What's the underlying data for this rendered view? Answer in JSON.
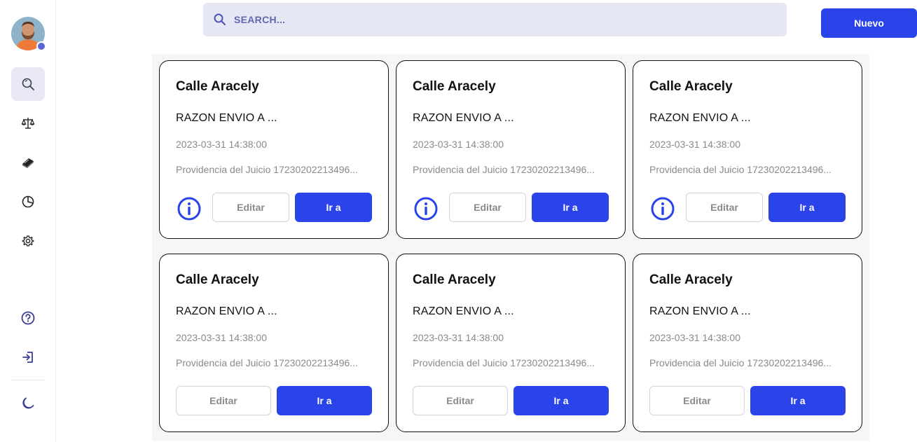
{
  "search": {
    "placeholder": "SEARCH..."
  },
  "header": {
    "new_button": "Nuevo"
  },
  "sidebar": {
    "items": [
      {
        "name": "search",
        "icon": "search-icon",
        "active": true
      },
      {
        "name": "justice",
        "icon": "scale-icon",
        "active": false
      },
      {
        "name": "books",
        "icon": "book-icon",
        "active": false
      },
      {
        "name": "reports",
        "icon": "pie-chart-icon",
        "active": false
      },
      {
        "name": "settings",
        "icon": "gear-icon",
        "active": false
      },
      {
        "name": "help",
        "icon": "help-icon",
        "active": false
      },
      {
        "name": "logout",
        "icon": "logout-icon",
        "active": false
      },
      {
        "name": "theme",
        "icon": "moon-icon",
        "active": false
      }
    ]
  },
  "cards": [
    {
      "title": "Calle Aracely",
      "razon": "RAZON ENVIO A ...",
      "fecha": "2023-03-31 14:38:00",
      "providencia": "Providencia del Juicio 17230202213496...",
      "editar": "Editar",
      "ira": "Ir a",
      "info": true
    },
    {
      "title": "Calle Aracely",
      "razon": "RAZON ENVIO A ...",
      "fecha": "2023-03-31 14:38:00",
      "providencia": "Providencia del Juicio 17230202213496...",
      "editar": "Editar",
      "ira": "Ir a",
      "info": true
    },
    {
      "title": "Calle Aracely",
      "razon": "RAZON ENVIO A ...",
      "fecha": "2023-03-31 14:38:00",
      "providencia": "Providencia del Juicio 17230202213496...",
      "editar": "Editar",
      "ira": "Ir a",
      "info": true
    },
    {
      "title": "Calle Aracely",
      "razon": "RAZON ENVIO A ...",
      "fecha": "2023-03-31 14:38:00",
      "providencia": "Providencia del Juicio 17230202213496...",
      "editar": "Editar",
      "ira": "Ir a",
      "info": false
    },
    {
      "title": "Calle Aracely",
      "razon": "RAZON ENVIO A ...",
      "fecha": "2023-03-31 14:38:00",
      "providencia": "Providencia del Juicio 17230202213496...",
      "editar": "Editar",
      "ira": "Ir a",
      "info": false
    },
    {
      "title": "Calle Aracely",
      "razon": "RAZON ENVIO A ...",
      "fecha": "2023-03-31 14:38:00",
      "providencia": "Providencia del Juicio 17230202213496...",
      "editar": "Editar",
      "ira": "Ir a",
      "info": false
    }
  ],
  "colors": {
    "accent": "#2a44ea",
    "sidebar_icon": "#3a3f8f",
    "search_bg": "#e6e7f4"
  }
}
